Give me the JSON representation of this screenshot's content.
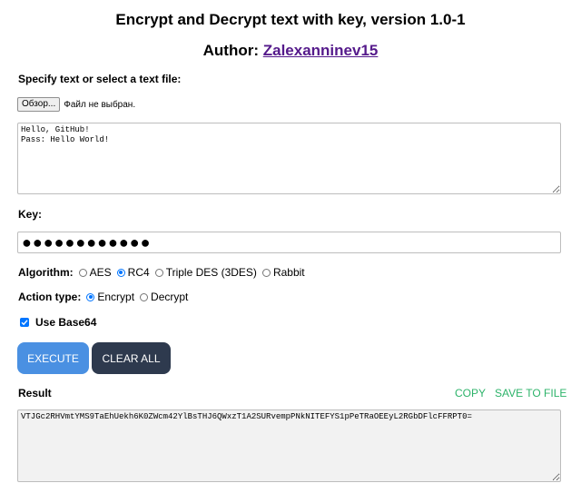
{
  "header": {
    "title": "Encrypt and Decrypt text with key, version 1.0-1",
    "author_prefix": "Author: ",
    "author_name": "Zalexanninev15"
  },
  "input": {
    "label": "Specify text or select a text file:",
    "file_button": "Обзор...",
    "file_status": "Файл не выбран.",
    "text": "Hello, GitHub!\nPass: Hello World!"
  },
  "key": {
    "label": "Key:",
    "value": "●●●●●●●●●●●●"
  },
  "algorithm": {
    "label": "Algorithm:",
    "options": [
      "AES",
      "RC4",
      "Triple DES (3DES)",
      "Rabbit"
    ],
    "selected": "RC4"
  },
  "action": {
    "label": "Action type:",
    "options": [
      "Encrypt",
      "Decrypt"
    ],
    "selected": "Encrypt"
  },
  "base64": {
    "label": "Use Base64",
    "checked": true
  },
  "buttons": {
    "execute": "EXECUTE",
    "clear_all": "CLEAR ALL"
  },
  "result": {
    "label": "Result",
    "copy": "COPY",
    "save": "SAVE TO FILE",
    "text": "VTJGc2RHVmtYMS9TaEhUekh6K0ZWcm42YlBsTHJ6QWxzT1A2SURvempPNkNITEFYS1pPeTRaOEEyL2RGbDFlcFFRPT0="
  },
  "colors": {
    "accent": "#0075ff",
    "execute_bg": "#4a90e2",
    "clear_bg": "#2e3a4e",
    "link_green": "#2db36a",
    "author_link": "#551a8b"
  }
}
